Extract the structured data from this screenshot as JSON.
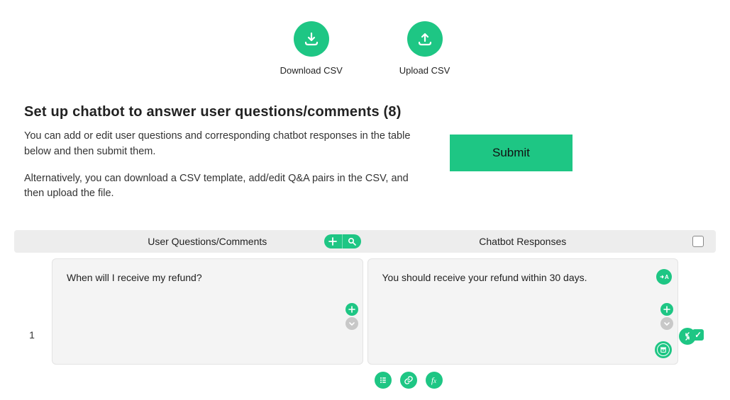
{
  "csv": {
    "download_label": "Download CSV",
    "upload_label": "Upload CSV"
  },
  "section": {
    "title": "Set up chatbot to answer user questions/comments (8)",
    "paragraph1": "You can add or edit user questions and corresponding chatbot responses in the table below and then submit them.",
    "paragraph2": "Alternatively, you can download a CSV template, add/edit Q&A pairs in the CSV, and then upload the file.",
    "submit_label": "Submit"
  },
  "table": {
    "header_questions": "User Questions/Comments",
    "header_responses": "Chatbot Responses",
    "rows": [
      {
        "index": "1",
        "question": "When will I receive my refund?",
        "response": "You should receive your refund within 30 days.",
        "checked": true
      }
    ]
  }
}
